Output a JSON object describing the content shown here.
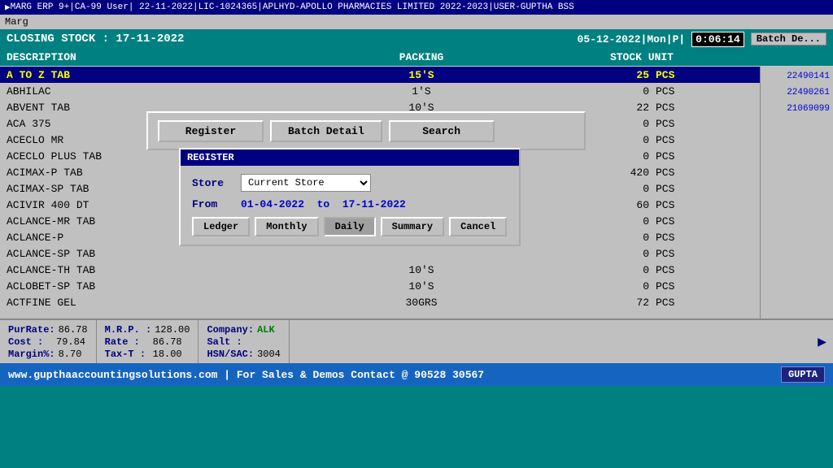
{
  "titlebar": {
    "text": "MARG ERP 9+|CA-99 User| 22-11-2022|LIC-1024365|APLHYD-APOLLO PHARMACIES LIMITED 2022-2023|USER-GUPTHA BSS"
  },
  "menubar": {
    "item": "Marg"
  },
  "header": {
    "closing_stock": "CLOSING STOCK : 17-11-2022",
    "date": "05-12-2022|Mon|P|",
    "time": "0:06:14",
    "batch_detail": "Batch De..."
  },
  "columns": {
    "description": "DESCRIPTION",
    "packing": "PACKING",
    "stock": "STOCK",
    "unit": "UNIT"
  },
  "rows": [
    {
      "desc": "A TO Z TAB",
      "pack": "15'S",
      "stock": "25",
      "unit": "PCS",
      "highlight": true
    },
    {
      "desc": "ABHILAC",
      "pack": "1'S",
      "stock": "0",
      "unit": "PCS",
      "highlight": false
    },
    {
      "desc": "ABVENT TAB",
      "pack": "10'S",
      "stock": "22",
      "unit": "PCS",
      "highlight": false
    },
    {
      "desc": "ACA 375",
      "pack": "",
      "stock": "0",
      "unit": "PCS",
      "highlight": false
    },
    {
      "desc": "ACECLO MR",
      "pack": "",
      "stock": "0",
      "unit": "PCS",
      "highlight": false
    },
    {
      "desc": "ACECLO PLUS TAB",
      "pack": "",
      "stock": "0",
      "unit": "PCS",
      "highlight": false
    },
    {
      "desc": "ACIMAX-P TAB",
      "pack": "",
      "stock": "420",
      "unit": "PCS",
      "highlight": false
    },
    {
      "desc": "ACIMAX-SP TAB",
      "pack": "",
      "stock": "0",
      "unit": "PCS",
      "highlight": false
    },
    {
      "desc": "ACIVIR 400 DT",
      "pack": "",
      "stock": "60",
      "unit": "PCS",
      "highlight": false
    },
    {
      "desc": "ACLANCE-MR TAB",
      "pack": "",
      "stock": "0",
      "unit": "PCS",
      "highlight": false
    },
    {
      "desc": "ACLANCE-P",
      "pack": "",
      "stock": "0",
      "unit": "PCS",
      "highlight": false
    },
    {
      "desc": "ACLANCE-SP TAB",
      "pack": "",
      "stock": "0",
      "unit": "PCS",
      "highlight": false
    },
    {
      "desc": "ACLANCE-TH TAB",
      "pack": "10'S",
      "stock": "0",
      "unit": "PCS",
      "highlight": false
    },
    {
      "desc": "ACLOBET-SP TAB",
      "pack": "10'S",
      "stock": "0",
      "unit": "PCS",
      "highlight": false
    },
    {
      "desc": "ACTFINE GEL",
      "pack": "30GRS",
      "stock": "72",
      "unit": "PCS",
      "highlight": false
    }
  ],
  "right_numbers": [
    "22490141",
    "22490261",
    "21069099"
  ],
  "button_bar": {
    "register": "Register",
    "batch_detail": "Batch Detail",
    "search": "Search"
  },
  "register_dialog": {
    "title": "REGISTER",
    "store_label": "Store",
    "store_value": "Current Store",
    "from_label": "From",
    "from_date": "01-04-2022",
    "to_text": "to",
    "to_date": "17-11-2022",
    "btn_ledger": "Ledger",
    "btn_monthly": "Monthly",
    "btn_daily": "Daily",
    "btn_summary": "Summary",
    "btn_cancel": "Cancel"
  },
  "status": {
    "pur_rate_label": "PurRate:",
    "pur_rate_value": "86.78",
    "cost_label": "Cost   :",
    "cost_value": "79.84",
    "margin_label": "Margin%:",
    "margin_value": "8.70",
    "mrp_label": "M.R.P. :",
    "mrp_value": "128.00",
    "rate_label": "Rate   :",
    "rate_value": "86.78",
    "taxt_label": "Tax-T  :",
    "taxt_value": "18.00",
    "company_label": "Company:",
    "company_value": "ALK",
    "salt_label": "Salt   :",
    "salt_value": "",
    "hsn_label": "HSN/SAC:",
    "hsn_value": "3004"
  },
  "footer": {
    "text": "www.gupthaaccountingsolutions.com | For Sales & Demos Contact @ 90528 30567",
    "logo": "GUPTA"
  }
}
